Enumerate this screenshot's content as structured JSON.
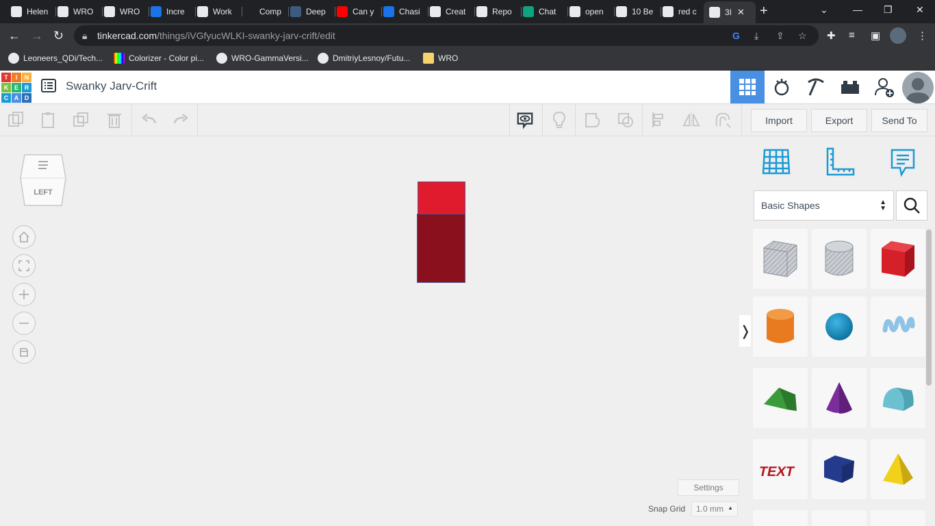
{
  "browser": {
    "tabs": [
      {
        "label": "Helen",
        "favicon": "github-icon",
        "color": "#e8eaed"
      },
      {
        "label": "WRO",
        "favicon": "github-icon",
        "color": "#e8eaed"
      },
      {
        "label": "WRO",
        "favicon": "wordpress-icon",
        "color": "#e8eaed"
      },
      {
        "label": "Incre",
        "favicon": "p-icon",
        "color": "#1a73e8"
      },
      {
        "label": "Work",
        "favicon": "github-icon",
        "color": "#e8eaed"
      },
      {
        "label": "Comp",
        "favicon": "blank-icon",
        "color": "#202124"
      },
      {
        "label": "Deep",
        "favicon": "tds-icon",
        "color": "#3d5a80"
      },
      {
        "label": "Can y",
        "favicon": "youtube-icon",
        "color": "#ff0000"
      },
      {
        "label": "Chasi",
        "favicon": "t-icon",
        "color": "#1a73e8"
      },
      {
        "label": "Creat",
        "favicon": "cc-icon",
        "color": "#e8eaed"
      },
      {
        "label": "Repo",
        "favicon": "github-icon",
        "color": "#e8eaed"
      },
      {
        "label": "Chat",
        "favicon": "openai-icon",
        "color": "#10a37f"
      },
      {
        "label": "open",
        "favicon": "google-icon",
        "color": "#e8eaed"
      },
      {
        "label": "10 Be",
        "favicon": "medium-icon",
        "color": "#e8eaed"
      },
      {
        "label": "red c",
        "favicon": "google-icon",
        "color": "#e8eaed"
      },
      {
        "label": "3I",
        "favicon": "tinkercad-icon",
        "color": "#e8eaed"
      }
    ],
    "url_host": "tinkercad.com",
    "url_path": "/things/iVGfyucWLKI-swanky-jarv-crift/edit",
    "bookmarks": [
      {
        "label": "Leoneers_QDi/Tech..."
      },
      {
        "label": "Colorizer - Color pi..."
      },
      {
        "label": "WRO-GammaVersi..."
      },
      {
        "label": "DmitriyLesnoy/Futu..."
      },
      {
        "label": "WRO"
      }
    ]
  },
  "app": {
    "logo_letters": [
      "T",
      "I",
      "N",
      "K",
      "E",
      "R",
      "C",
      "A",
      "D"
    ],
    "design_title": "Swanky Jarv-Crift",
    "actions": {
      "import": "Import",
      "export": "Export",
      "send_to": "Send To"
    },
    "viewcube_face": "LEFT",
    "settings_label": "Settings",
    "snap_grid_label": "Snap Grid",
    "snap_grid_value": "1.0 mm",
    "shape_category": "Basic Shapes",
    "panel_toggle": "❭",
    "colors": {
      "accent": "#4a90e2",
      "shape_top": "#e01b2e",
      "shape_bottom": "#8a101d",
      "icon_blue": "#1b9ad6"
    },
    "shape_tiles": [
      "box-hole-icon",
      "cylinder-hole-icon",
      "box-icon",
      "cylinder-icon",
      "sphere-icon",
      "scribble-icon",
      "roof-icon",
      "cone-icon",
      "round-roof-icon",
      "text-icon",
      "polygon-icon",
      "pyramid-icon"
    ],
    "text_tile_label": "TEXT"
  }
}
